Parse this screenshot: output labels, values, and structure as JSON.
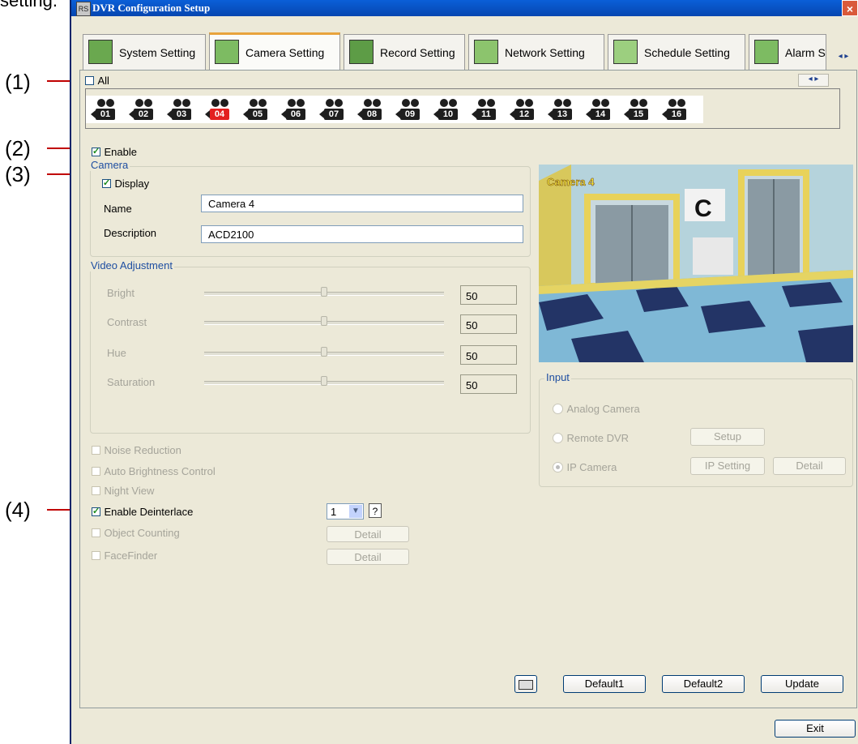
{
  "caption": "setting.",
  "callouts": [
    "(1)",
    "(2)",
    "(3)",
    "(4)"
  ],
  "window": {
    "title": "DVR Configuration Setup",
    "icon_text": "RS",
    "close_glyph": "×"
  },
  "tabs": [
    {
      "label": "System Setting",
      "icon": "monitor-icon"
    },
    {
      "label": "Camera Setting",
      "icon": "camera-setting-icon"
    },
    {
      "label": "Record Setting",
      "icon": "record-icon"
    },
    {
      "label": "Network Setting",
      "icon": "network-icon"
    },
    {
      "label": "Schedule Setting",
      "icon": "calendar-icon"
    },
    {
      "label": "Alarm Se",
      "icon": "alarm-speaker-icon"
    }
  ],
  "tab_scroll": "◂ ▸",
  "camera_strip_scroll": "◂ ▸",
  "all_label": "All",
  "cameras": [
    "01",
    "02",
    "03",
    "04",
    "05",
    "06",
    "07",
    "08",
    "09",
    "10",
    "11",
    "12",
    "13",
    "14",
    "15",
    "16"
  ],
  "selected_camera": "04",
  "enable_label": "Enable",
  "camera_group": {
    "legend": "Camera",
    "display_label": "Display",
    "name_label": "Name",
    "name_value": "Camera 4",
    "description_label": "Description",
    "description_value": "ACD2100"
  },
  "video_adjustment": {
    "legend": "Video Adjustment",
    "rows": [
      {
        "label": "Bright",
        "value": "50"
      },
      {
        "label": "Contrast",
        "value": "50"
      },
      {
        "label": "Hue",
        "value": "50"
      },
      {
        "label": "Saturation",
        "value": "50"
      }
    ]
  },
  "preview": {
    "overlay": "Camera 4",
    "sign": "C"
  },
  "options": [
    {
      "label": "Noise Reduction",
      "checked": false,
      "enabled": false
    },
    {
      "label": "Auto Brightness Control",
      "checked": false,
      "enabled": false
    },
    {
      "label": "Night View",
      "checked": false,
      "enabled": false
    },
    {
      "label": "Enable Deinterlace",
      "checked": true,
      "enabled": true
    },
    {
      "label": "Object Counting",
      "checked": false,
      "enabled": false
    },
    {
      "label": "FaceFinder",
      "checked": false,
      "enabled": false
    }
  ],
  "deinterlace_select": "1",
  "deinterlace_help": "?",
  "detail_label": "Detail",
  "input_group": {
    "legend": "Input",
    "analog": "Analog Camera",
    "remote": "Remote DVR",
    "setup": "Setup",
    "ip": "IP Camera",
    "ip_setting": "IP Setting",
    "detail": "Detail"
  },
  "bottom_buttons": {
    "keyboard_icon": "keyboard-icon",
    "default1": "Default1",
    "default2": "Default2",
    "update": "Update",
    "exit": "Exit"
  }
}
